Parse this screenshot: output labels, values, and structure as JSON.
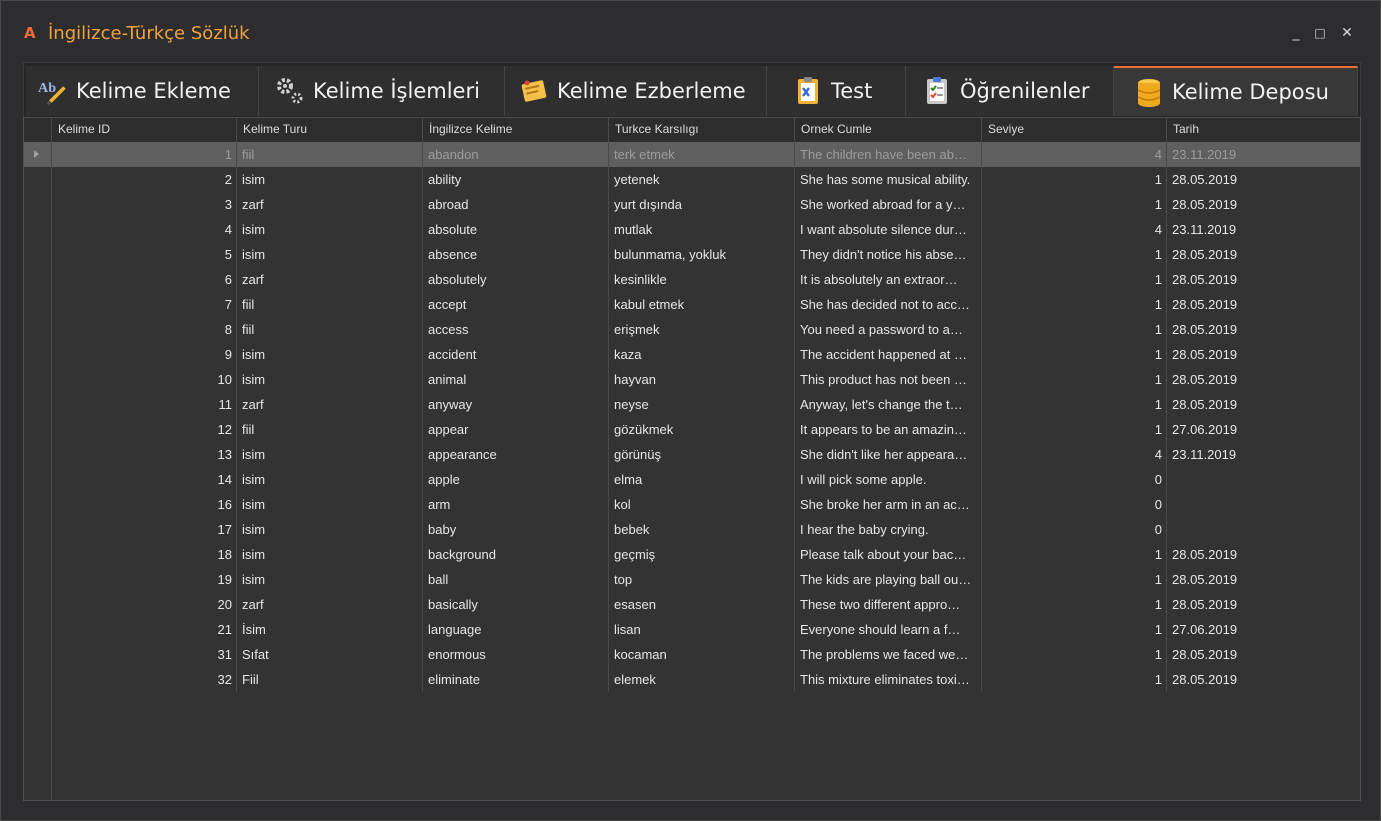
{
  "window": {
    "title": "İngilizce-Türkçe Sözlük",
    "app_icon": "logo-icon",
    "buttons": {
      "minimize": "_",
      "maximize": "□",
      "close": "✕"
    }
  },
  "tabs": [
    {
      "label": "Kelime Ekleme",
      "icon": "text-edit-icon"
    },
    {
      "label": "Kelime İşlemleri",
      "icon": "gears-icon"
    },
    {
      "label": "Kelime Ezberleme",
      "icon": "notes-icon"
    },
    {
      "label": "Test",
      "icon": "clipboard-icon"
    },
    {
      "label": "Öğrenilenler",
      "icon": "checklist-icon"
    },
    {
      "label": "Kelime Deposu",
      "icon": "database-icon",
      "active": true
    }
  ],
  "table": {
    "columns": [
      "Kelime ID",
      "Kelime Turu",
      "İngilizce Kelime",
      "Turkce Karsılıgı",
      "Ornek Cumle",
      "Seviye",
      "Tarih"
    ],
    "rows": [
      [
        "1",
        "fiil",
        "abandon",
        "terk etmek",
        "The children have been ab…",
        "4",
        "23.11.2019"
      ],
      [
        "2",
        "isim",
        "ability",
        "yetenek",
        "She has some musical ability.",
        "1",
        "28.05.2019"
      ],
      [
        "3",
        "zarf",
        "abroad",
        "yurt dışında",
        "She worked abroad for a y…",
        "1",
        "28.05.2019"
      ],
      [
        "4",
        "isim",
        " absolute",
        "mutlak",
        "I want absolute silence dur…",
        "4",
        "23.11.2019"
      ],
      [
        "5",
        "isim",
        "absence",
        "bulunmama, yokluk",
        "They didn't notice his abse…",
        "1",
        "28.05.2019"
      ],
      [
        "6",
        "zarf",
        "absolutely",
        "kesinlikle",
        "It is absolutely an extraor…",
        "1",
        "28.05.2019"
      ],
      [
        "7",
        "fiil",
        "accept",
        "kabul etmek",
        "She has decided not to acc…",
        "1",
        "28.05.2019"
      ],
      [
        "8",
        "fiil",
        "access",
        "erişmek",
        "You need a password to a…",
        "1",
        "28.05.2019"
      ],
      [
        "9",
        "isim",
        "accident",
        "kaza",
        "The accident happened at …",
        "1",
        "28.05.2019"
      ],
      [
        "10",
        "isim",
        "animal",
        "hayvan",
        "This product has not been …",
        "1",
        "28.05.2019"
      ],
      [
        "11",
        "zarf",
        "anyway",
        "neyse",
        "Anyway, let's change the t…",
        "1",
        "28.05.2019"
      ],
      [
        "12",
        "fiil",
        "appear",
        "gözükmek",
        "It appears to be an amazin…",
        "1",
        "27.06.2019"
      ],
      [
        "13",
        "isim",
        "appearance",
        "görünüş",
        "She didn't like her appeara…",
        "4",
        "23.11.2019"
      ],
      [
        "14",
        "isim",
        "apple",
        "elma",
        "I will pick some apple.",
        "0",
        ""
      ],
      [
        "16",
        "isim",
        "arm",
        "kol",
        "She broke her arm in an ac…",
        "0",
        ""
      ],
      [
        "17",
        "isim",
        "baby",
        "bebek",
        "I hear the baby crying.",
        "0",
        ""
      ],
      [
        "18",
        "isim",
        "background",
        "geçmiş",
        "Please talk about your bac…",
        "1",
        "28.05.2019"
      ],
      [
        "19",
        "isim",
        "ball",
        "top",
        "The kids are playing ball ou…",
        "1",
        "28.05.2019"
      ],
      [
        "20",
        "zarf",
        "basically",
        "esasen",
        "These two different appro…",
        "1",
        "28.05.2019"
      ],
      [
        "21",
        "İsim",
        "language",
        "lisan",
        "Everyone should learn a f…",
        "1",
        "27.06.2019"
      ],
      [
        "31",
        "Sıfat",
        "enormous",
        "kocaman",
        "The problems we faced we…",
        "1",
        "28.05.2019"
      ],
      [
        "32",
        "Fiil",
        " eliminate",
        "elemek",
        "This mixture eliminates toxi…",
        "1",
        "28.05.2019"
      ]
    ],
    "selected_row": 0
  },
  "colors": {
    "accent": "#e8713a",
    "title": "#f0a23a"
  }
}
